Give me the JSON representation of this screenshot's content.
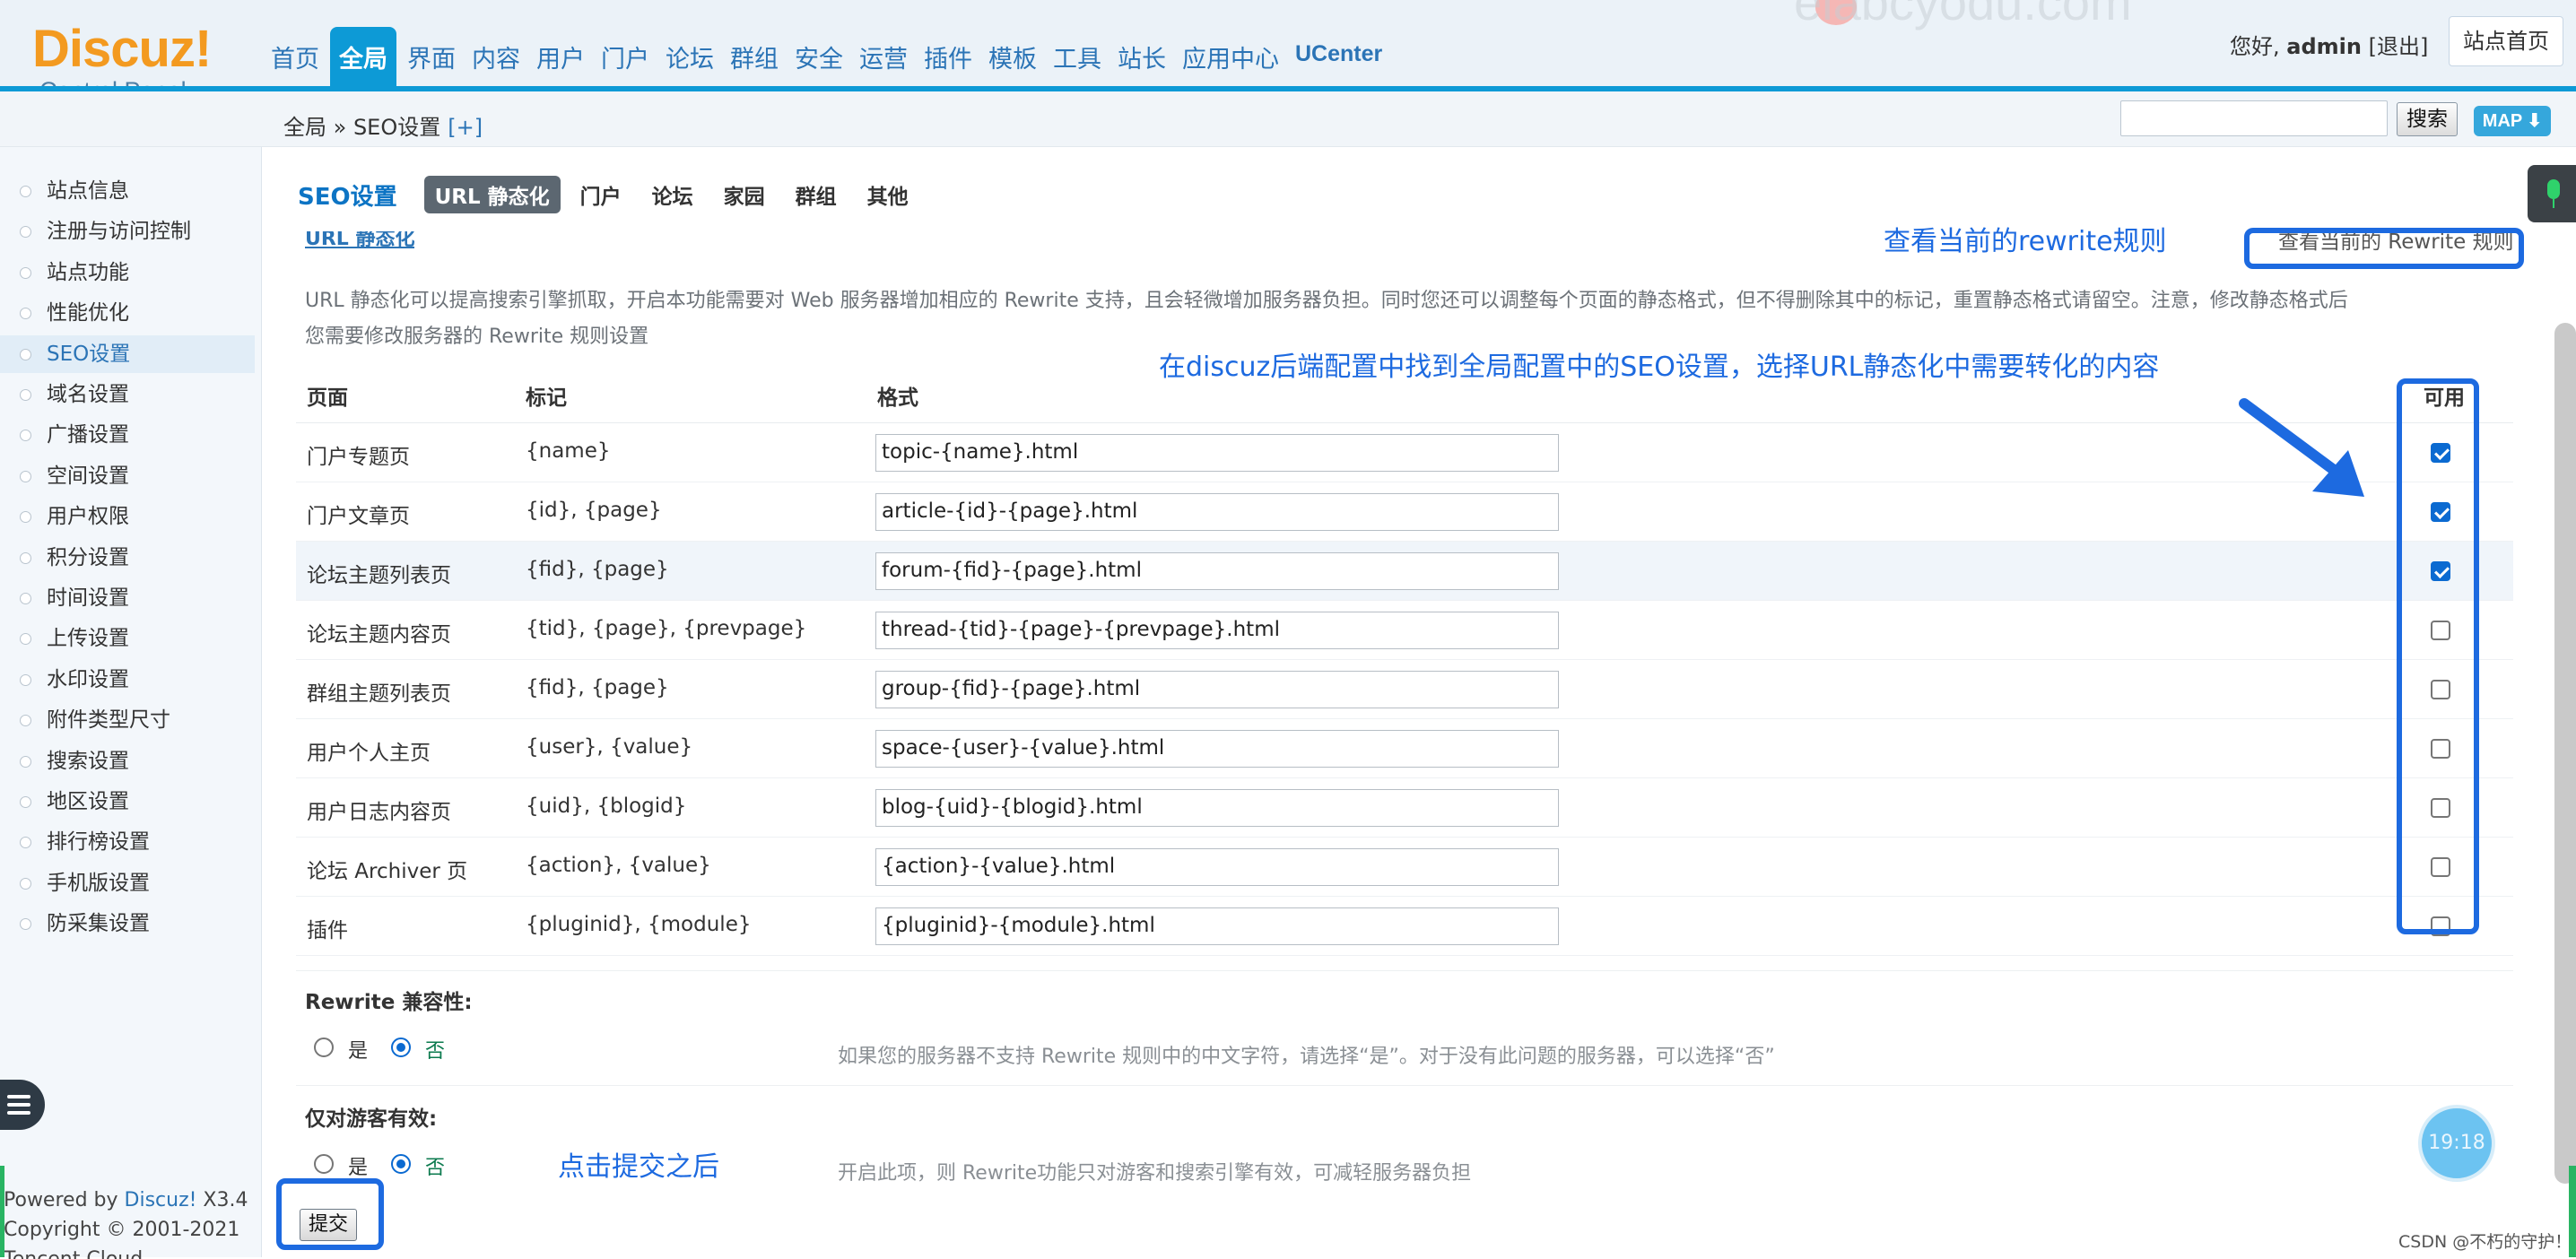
{
  "header": {
    "logo_main": "Discuz!",
    "logo_sub": "Control Panel",
    "watermark": "elabcyodu.com",
    "nav": [
      "首页",
      "全局",
      "界面",
      "内容",
      "用户",
      "门户",
      "论坛",
      "群组",
      "安全",
      "运营",
      "插件",
      "模板",
      "工具",
      "站长",
      "应用中心",
      "UCenter"
    ],
    "nav_active": "全局",
    "greeting_prefix": "您好,",
    "username": "admin",
    "logout": "[退出]",
    "home_button": "站点首页"
  },
  "subbar": {
    "breadcrumb": "全局 » SEO设置",
    "breadcrumb_plus": "[+]",
    "search_button": "搜索",
    "map_button": "MAP ⬇"
  },
  "sidebar": {
    "items": [
      "站点信息",
      "注册与访问控制",
      "站点功能",
      "性能优化",
      "SEO设置",
      "域名设置",
      "广播设置",
      "空间设置",
      "用户权限",
      "积分设置",
      "时间设置",
      "上传设置",
      "水印设置",
      "附件类型尺寸",
      "搜索设置",
      "地区设置",
      "排行榜设置",
      "手机版设置",
      "防采集设置"
    ],
    "active": "SEO设置",
    "powered_line1_prefix": "Powered by ",
    "powered_brand": "Discuz!",
    "powered_version": " X3.4",
    "copyright": "Copyright © 2001-2021",
    "footer_cut": "Tencent Cloud"
  },
  "main": {
    "tab_title": "SEO设置",
    "tabs": [
      "URL 静态化",
      "门户",
      "论坛",
      "家园",
      "群组",
      "其他"
    ],
    "tab_active": "URL 静态化",
    "section_title": "URL 静态化",
    "rewrite_link": "查看当前的 Rewrite 规则",
    "description_line1": "URL 静态化可以提高搜索引擎抓取，开启本功能需要对 Web 服务器增加相应的 Rewrite 支持，且会轻微增加服务器负担。同时您还可以调整每个页面的静态格式，但不得删除其中的标记，重置静态格式请留空。注意，修改静态格式后",
    "description_line2": "您需要修改服务器的 Rewrite 规则设置",
    "columns": {
      "page": "页面",
      "mark": "标记",
      "format": "格式",
      "enabled": "可用"
    },
    "rows": [
      {
        "page": "门户专题页",
        "mark": "{name}",
        "format": "topic-{name}.html",
        "enabled": true
      },
      {
        "page": "门户文章页",
        "mark": "{id}, {page}",
        "format": "article-{id}-{page}.html",
        "enabled": true
      },
      {
        "page": "论坛主题列表页",
        "mark": "{fid}, {page}",
        "format": "forum-{fid}-{page}.html",
        "enabled": true
      },
      {
        "page": "论坛主题内容页",
        "mark": "{tid}, {page}, {prevpage}",
        "format": "thread-{tid}-{page}-{prevpage}.html",
        "enabled": false
      },
      {
        "page": "群组主题列表页",
        "mark": "{fid}, {page}",
        "format": "group-{fid}-{page}.html",
        "enabled": false
      },
      {
        "page": "用户个人主页",
        "mark": "{user}, {value}",
        "format": "space-{user}-{value}.html",
        "enabled": false
      },
      {
        "page": "用户日志内容页",
        "mark": "{uid}, {blogid}",
        "format": "blog-{uid}-{blogid}.html",
        "enabled": false
      },
      {
        "page": "论坛 Archiver 页",
        "mark": "{action}, {value}",
        "format": "{action}-{value}.html",
        "enabled": false
      },
      {
        "page": "插件",
        "mark": "{pluginid}, {module}",
        "format": "{pluginid}-{module}.html",
        "enabled": false
      }
    ],
    "rewrite_compat": {
      "label": "Rewrite 兼容性:",
      "yes": "是",
      "no": "否",
      "selected": "否",
      "hint": "如果您的服务器不支持 Rewrite 规则中的中文字符，请选择“是”。对于没有此问题的服务器，可以选择“否”"
    },
    "guest_only": {
      "label": "仅对游客有效:",
      "yes": "是",
      "no": "否",
      "selected": "否",
      "hint": "开启此项，则 Rewrite功能只对游客和搜索引擎有效，可减轻服务器负担"
    },
    "submit": "提交"
  },
  "annotations": {
    "rewrite_note": "查看当前的rewrite规则",
    "main_note": "在discuz后端配置中找到全局配置中的SEO设置，选择URL静态化中需要转化的内容",
    "submit_note": "点击提交之后",
    "color": "#1d6ae0"
  },
  "overlay": {
    "clock": "19:18",
    "csdn": "CSDN @不朽的守护！"
  }
}
